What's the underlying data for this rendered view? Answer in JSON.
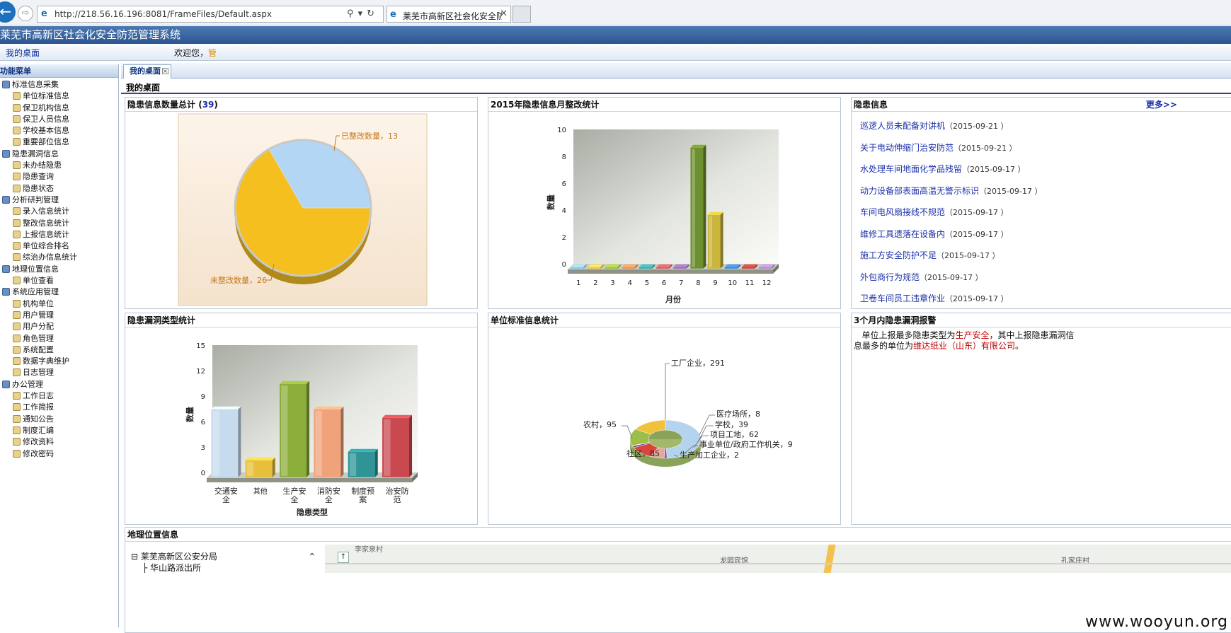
{
  "browser": {
    "url": "http://218.56.16.196:8081/FrameFiles/Default.aspx",
    "tab_title": "莱芜市高新区社会化安全防..."
  },
  "app": {
    "title": "莱芜市高新区社会化安全防范管理系统",
    "home_link": "我的桌面",
    "welcome": "欢迎您，",
    "user": "管"
  },
  "sidebar": {
    "title": "功能菜单",
    "groups": [
      {
        "label": "标准信息采集",
        "items": [
          "单位标准信息",
          "保卫机构信息",
          "保卫人员信息",
          "学校基本信息",
          "重要部位信息"
        ]
      },
      {
        "label": "隐患漏洞信息",
        "items": [
          "未办结隐患",
          "隐患查询",
          "隐患状态"
        ]
      },
      {
        "label": "分析研判管理",
        "items": [
          "录入信息统计",
          "整改信息统计",
          "上报信息统计",
          "单位综合排名",
          "综治办信息统计"
        ]
      },
      {
        "label": "地理位置信息",
        "items": [
          "单位查看"
        ]
      },
      {
        "label": "系统应用管理",
        "items": [
          "机构单位",
          "用户管理",
          "用户分配",
          "角色管理",
          "系统配置",
          "数据字典维护",
          "日志管理"
        ]
      },
      {
        "label": "办公管理",
        "items": [
          "工作日志",
          "工作简报",
          "通知公告",
          "制度汇编",
          "修改资料",
          "修改密码"
        ]
      }
    ]
  },
  "tabs": {
    "active": "我的桌面"
  },
  "desk_title": "我的桌面",
  "panels": {
    "total": {
      "title": "隐患信息数量总计",
      "count": "39"
    },
    "monthly": {
      "title": "2015年隐患信息月整改统计"
    },
    "risk_info": {
      "title": "隐患信息",
      "more": "更多>>",
      "items": [
        {
          "text": "巡逻人员未配备对讲机",
          "date": "（2015-09-21 ）"
        },
        {
          "text": "关于电动伸缩门治安防范",
          "date": "（2015-09-21 ）"
        },
        {
          "text": "水处理车间地面化学品残留",
          "date": "（2015-09-17 ）"
        },
        {
          "text": "动力设备部表面高温无警示标识",
          "date": "（2015-09-17 ）"
        },
        {
          "text": "车间电风扇接线不规范",
          "date": "（2015-09-17 ）"
        },
        {
          "text": "维修工具遗落在设备内",
          "date": "（2015-09-17 ）"
        },
        {
          "text": "施工方安全防护不足",
          "date": "（2015-09-17 ）"
        },
        {
          "text": "外包商行为规范",
          "date": "（2015-09-17 ）"
        },
        {
          "text": "卫卷车间员工违章作业",
          "date": "（2015-09-17 ）"
        }
      ]
    },
    "type_stats": {
      "title": "隐患漏洞类型统计"
    },
    "unit_stats": {
      "title": "单位标准信息统计"
    },
    "alarm": {
      "title": "3个月内隐患漏洞报警",
      "line1_a": "单位上报最多隐患类型为",
      "line1_type": "生产安全",
      "line1_b": "，其中上报隐患漏洞信息最多的单位为",
      "line1_unit": "维达纸业（山东）有限公司",
      "line1_c": "。"
    },
    "map": {
      "title": "地理位置信息",
      "root": "莱芜高新区公安分局",
      "child": "华山路派出所",
      "labels": [
        "李家泉村",
        "龙园宾馆",
        "孔家庄村"
      ]
    }
  },
  "watermark": "www.wooyun.org",
  "chart_data": [
    {
      "type": "pie",
      "title": "",
      "labels": [
        "已整改数量",
        "未整改数量"
      ],
      "values": [
        13,
        26
      ],
      "colors": [
        "#b4d6f5",
        "#f5c01f"
      ]
    },
    {
      "type": "bar",
      "title": "",
      "xlabel": "月份",
      "ylabel": "数量",
      "categories": [
        "1",
        "2",
        "3",
        "4",
        "5",
        "6",
        "7",
        "8",
        "9",
        "10",
        "11",
        "12"
      ],
      "values": [
        0,
        0,
        0,
        0,
        0,
        0,
        0,
        9,
        4,
        0,
        0,
        0
      ],
      "ylim": [
        0,
        10
      ],
      "yticks": [
        0,
        2,
        4,
        6,
        8,
        10
      ],
      "colors": [
        "#8fc4ef",
        "#e9c54a",
        "#9bbf3d",
        "#e48f5b",
        "#3ba7a8",
        "#d05c63",
        "#9a6ab4",
        "#6e8f2f",
        "#c9b63a",
        "#3f86d1",
        "#c0453f",
        "#b08ac5"
      ]
    },
    {
      "type": "bar",
      "title": "",
      "xlabel": "隐患类型",
      "ylabel": "数量",
      "categories": [
        "交通安全",
        "其他",
        "生产安全",
        "消防安全",
        "制度预案",
        "治安防范"
      ],
      "values": [
        8,
        2,
        11,
        8,
        3,
        7
      ],
      "ylim": [
        0,
        15
      ],
      "yticks": [
        0,
        3,
        6,
        9,
        12,
        15
      ],
      "colors": [
        "#c7dbef",
        "#e7bf3a",
        "#8bad3a",
        "#f0a27a",
        "#2e9496",
        "#c9494f"
      ]
    },
    {
      "type": "pie",
      "title": "",
      "labels": [
        "工厂企业",
        "医疗场所",
        "学校",
        "项目工地",
        "事业单位/政府工作机关",
        "生产加工企业",
        "社区",
        "农村"
      ],
      "values": [
        291,
        8,
        39,
        62,
        9,
        2,
        85,
        95
      ],
      "colors": [
        "#b4d3ef",
        "#8d5fa6",
        "#e5a99a",
        "#d9443b",
        "#7c4f98",
        "#c4b32a",
        "#9cbf4a",
        "#f0c23c"
      ]
    }
  ]
}
